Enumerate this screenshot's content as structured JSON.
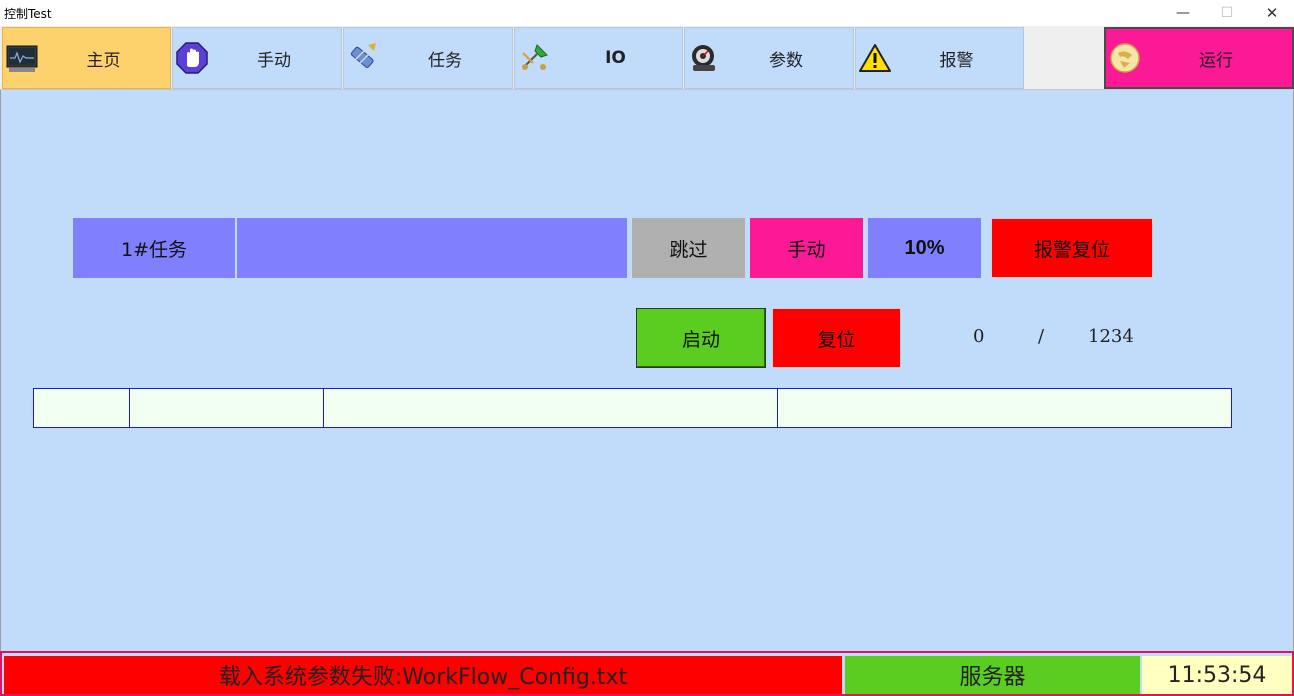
{
  "window": {
    "title": "控制Test",
    "min_glyph": "—",
    "max_glyph": "☐",
    "close_glyph": "✕"
  },
  "nav": [
    {
      "label": "主页",
      "icon": "monitor-icon",
      "active": true
    },
    {
      "label": "手动",
      "icon": "hand-stop-icon"
    },
    {
      "label": "任务",
      "icon": "brush-icon"
    },
    {
      "label": "IO",
      "icon": "connector-icon"
    },
    {
      "label": "参数",
      "icon": "gear-gauge-icon"
    },
    {
      "label": "报警",
      "icon": "warning-icon"
    },
    {
      "label": "运行",
      "icon": "run-icon"
    }
  ],
  "task": {
    "name": "1#任务",
    "progress_text": "",
    "skip_label": "跳过",
    "mode_label": "手动",
    "percent": "10%",
    "alarm_reset_label": "报警复位",
    "start_label": "启动",
    "reset_label": "复位",
    "count_current": "0",
    "count_sep": "/",
    "count_total": "1234"
  },
  "status": {
    "message": "载入系统参数失败:WorkFlow_Config.txt",
    "server": "服务器",
    "time": "11:53:54"
  },
  "colors": {
    "main_bg": "#c1dbfb",
    "nav_active": "#fdd16b",
    "run": "#fc1996",
    "task_blue": "#8080ff",
    "green": "#5acd20",
    "red": "#ff0000",
    "grid_bg": "#f0fff0",
    "grid_border": "#1a1adc"
  }
}
